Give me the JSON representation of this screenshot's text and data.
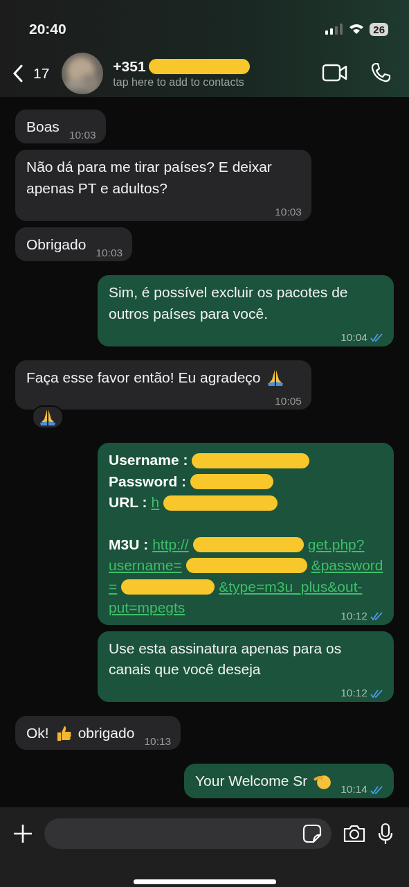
{
  "status_bar": {
    "time": "20:40",
    "battery": "26"
  },
  "header": {
    "back_count": "17",
    "title": "+351",
    "title_redacted": true,
    "subtitle": "tap here to add to contacts"
  },
  "messages": [
    {
      "kind": "incoming",
      "parts": [
        {
          "kind": "text",
          "text": "Boas"
        }
      ],
      "time": "10:03"
    },
    {
      "kind": "incoming",
      "parts": [
        {
          "kind": "text",
          "text": "Não dá para me tirar países? E deixar apenas PT e adultos?"
        }
      ],
      "time": "10:03"
    },
    {
      "kind": "incoming",
      "parts": [
        {
          "kind": "text",
          "text": "Obrigado"
        }
      ],
      "time": "10:03"
    },
    {
      "kind": "outgoing",
      "parts": [
        {
          "kind": "text",
          "text": "Sim, é possível excluir os pacotes de outros países para você."
        }
      ],
      "time": "10:04",
      "read": true
    },
    {
      "kind": "incoming",
      "parts": [
        {
          "kind": "text",
          "text": "Faça esse favor então! Eu agradeço"
        },
        {
          "kind": "praying"
        }
      ],
      "time": "10:05",
      "reaction": {
        "kind": "praying"
      }
    },
    {
      "kind": "credentials",
      "lines": [
        {
          "parts": [
            {
              "kind": "label",
              "text": "Username :"
            },
            {
              "kind": "redaction"
            }
          ]
        },
        {
          "parts": [
            {
              "kind": "label",
              "text": "Password :"
            },
            {
              "kind": "redaction"
            }
          ]
        },
        {
          "parts": [
            {
              "kind": "label",
              "text": "URL :"
            },
            {
              "kind": "link",
              "text": "h"
            },
            {
              "kind": "redaction"
            }
          ]
        },
        {
          "gap_before": true,
          "parts": [
            {
              "kind": "label",
              "text": "M3U :"
            },
            {
              "kind": "link",
              "text": "http://"
            },
            {
              "kind": "redaction"
            },
            {
              "kind": "link",
              "text": "get.php?"
            }
          ]
        },
        {
          "parts": [
            {
              "kind": "link",
              "text": "username="
            },
            {
              "kind": "redaction"
            },
            {
              "kind": "link",
              "text": "&password"
            }
          ]
        },
        {
          "parts": [
            {
              "kind": "link",
              "text": "="
            },
            {
              "kind": "redaction"
            },
            {
              "kind": "link",
              "text": "&type=m3u_plus&out-"
            }
          ]
        },
        {
          "parts": [
            {
              "kind": "link",
              "text": "put=mpegts"
            }
          ]
        }
      ],
      "time": "10:12",
      "read": true
    },
    {
      "kind": "outgoing",
      "parts": [
        {
          "kind": "text",
          "text": "Use esta assinatura apenas para os canais que você deseja"
        }
      ],
      "time": "10:12",
      "read": true
    },
    {
      "kind": "incoming",
      "parts": [
        {
          "kind": "text",
          "text": "Ok!"
        },
        {
          "kind": "thumbs"
        },
        {
          "kind": "text",
          "text": "obrigado"
        }
      ],
      "time": "10:13"
    },
    {
      "kind": "outgoing",
      "parts": [
        {
          "kind": "text",
          "text": "Your Welcome Sr"
        },
        {
          "kind": "salute"
        }
      ],
      "time": "10:14",
      "read": true
    }
  ]
}
